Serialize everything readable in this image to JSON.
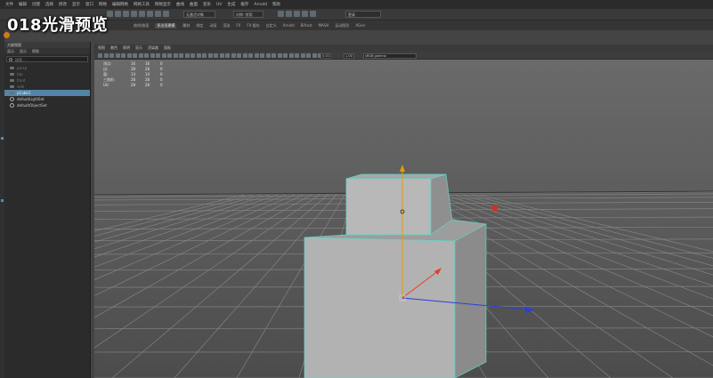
{
  "overlay_title": "018光滑预览",
  "menubar": {
    "items": [
      "文件",
      "编辑",
      "创建",
      "选择",
      "修改",
      "显示",
      "窗口",
      "网格",
      "编辑网格",
      "网格工具",
      "网格显示",
      "曲线",
      "曲面",
      "变形",
      "UV",
      "生成",
      "缓存",
      "Arnold",
      "帮助"
    ]
  },
  "toolbar": {
    "combo1": "无激活对象",
    "combo2": "对称: 禁用",
    "search": "登录"
  },
  "shelf": {
    "tabs": [
      "曲线/曲面",
      "多边形建模",
      "雕刻",
      "绑定",
      "动画",
      "渲染",
      "FX",
      "FX 缓存",
      "自定义",
      "Arnold",
      "Bifrost",
      "MASH",
      "运动图形",
      "XGen"
    ],
    "active_index": 1
  },
  "outliner": {
    "title": "大纲视图",
    "menu": [
      "显示",
      "显示",
      "帮助"
    ],
    "search_placeholder": "搜索...",
    "items": [
      {
        "label": "persp",
        "state": "dim"
      },
      {
        "label": "top",
        "state": "dim"
      },
      {
        "label": "front",
        "state": "dim"
      },
      {
        "label": "side",
        "state": "dim"
      },
      {
        "label": "pCube1",
        "state": "selected"
      },
      {
        "label": "defaultLightSet",
        "state": "bright"
      },
      {
        "label": "defaultObjectSet",
        "state": "bright"
      }
    ]
  },
  "viewport": {
    "menu": [
      "视图",
      "着色",
      "照明",
      "显示",
      "渲染器",
      "面板"
    ],
    "exposure": "0.00",
    "gamma": "1.00",
    "color_space": "sRGB gamma"
  },
  "hud": {
    "rows": [
      [
        "顶点:",
        "16",
        "16",
        "0"
      ],
      [
        "边:",
        "28",
        "28",
        "0"
      ],
      [
        "面:",
        "14",
        "14",
        "0"
      ],
      [
        "三角形:",
        "28",
        "28",
        "0"
      ],
      [
        "UV:",
        "28",
        "28",
        "0"
      ]
    ]
  },
  "colors": {
    "accent_selected": "#5285a6",
    "move_x_axis": "#2b3fd6",
    "move_y_axis": "#e0a000",
    "move_z_axis": "#e04020",
    "wireframe_highlight": "#5fd6c6"
  }
}
